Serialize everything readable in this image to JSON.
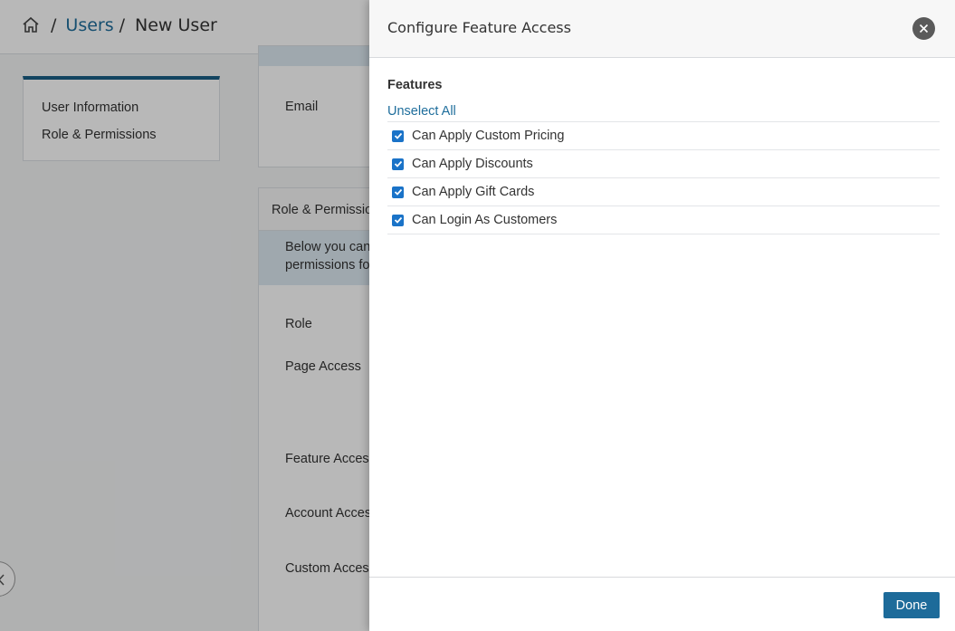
{
  "breadcrumb": {
    "home_icon": "home-icon",
    "users": "Users",
    "current": "New User",
    "separator": "/"
  },
  "leftnav": {
    "items": [
      {
        "label": "User Information"
      },
      {
        "label": "Role & Permissions"
      }
    ]
  },
  "form": {
    "email_label": "Email",
    "role_permissions_header": "Role & Permissio",
    "info_line1": "Below you can",
    "info_line2": "permissions fo",
    "role_label": "Role",
    "page_access_label": "Page Access",
    "feature_access_label": "Feature Access",
    "account_access_label": "Account Acces",
    "custom_access_label": "Custom Access"
  },
  "drawer": {
    "title": "Configure Feature Access",
    "close_icon": "close-icon",
    "section_title": "Features",
    "unselect_all": "Unselect All",
    "features": [
      {
        "label": "Can Apply Custom Pricing",
        "checked": true
      },
      {
        "label": "Can Apply Discounts",
        "checked": true
      },
      {
        "label": "Can Apply Gift Cards",
        "checked": true
      },
      {
        "label": "Can Login As Customers",
        "checked": true
      }
    ],
    "done_label": "Done"
  },
  "colors": {
    "accent": "#1d6b9a",
    "link": "#1f6e9c",
    "checkbox": "#1a73c8"
  }
}
